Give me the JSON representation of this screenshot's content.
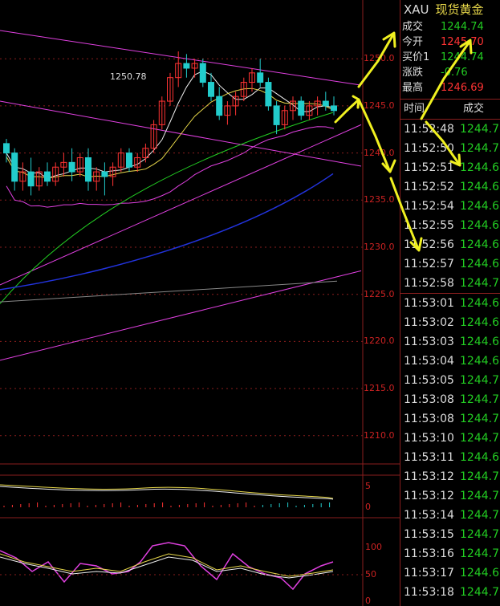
{
  "chart": {
    "high_callout": "1250.78",
    "price_axis": [
      "1250.0",
      "1245.0",
      "1240.0",
      "1235.0",
      "1230.0",
      "1225.0",
      "1220.0",
      "1215.0",
      "1210.0"
    ],
    "osc1_axis": [
      "5",
      "0"
    ],
    "osc2_axis": [
      "100",
      "50",
      "0"
    ]
  },
  "chart_data": {
    "type": "candlestick",
    "ylim": [
      1207,
      1253
    ],
    "yticks": [
      1250.0,
      1245.0,
      1240.0,
      1235.0,
      1230.0,
      1225.0,
      1220.0,
      1215.0,
      1210.0
    ],
    "candles": [
      {
        "o": 1241.0,
        "h": 1241.5,
        "l": 1239.0,
        "c": 1240.0
      },
      {
        "o": 1240.0,
        "h": 1240.5,
        "l": 1236.0,
        "c": 1237.0
      },
      {
        "o": 1237.0,
        "h": 1239.0,
        "l": 1236.0,
        "c": 1238.0
      },
      {
        "o": 1238.0,
        "h": 1239.5,
        "l": 1235.5,
        "c": 1236.5
      },
      {
        "o": 1236.5,
        "h": 1238.5,
        "l": 1236.0,
        "c": 1238.0
      },
      {
        "o": 1238.0,
        "h": 1239.0,
        "l": 1236.5,
        "c": 1237.0
      },
      {
        "o": 1237.0,
        "h": 1239.0,
        "l": 1236.5,
        "c": 1238.5
      },
      {
        "o": 1238.5,
        "h": 1240.0,
        "l": 1237.5,
        "c": 1239.0
      },
      {
        "o": 1239.0,
        "h": 1240.5,
        "l": 1237.0,
        "c": 1238.0
      },
      {
        "o": 1238.0,
        "h": 1240.0,
        "l": 1237.5,
        "c": 1239.5
      },
      {
        "o": 1239.5,
        "h": 1240.5,
        "l": 1236.0,
        "c": 1237.0
      },
      {
        "o": 1237.0,
        "h": 1238.5,
        "l": 1236.0,
        "c": 1238.0
      },
      {
        "o": 1238.0,
        "h": 1239.0,
        "l": 1235.5,
        "c": 1237.5
      },
      {
        "o": 1237.5,
        "h": 1239.0,
        "l": 1236.5,
        "c": 1238.5
      },
      {
        "o": 1238.5,
        "h": 1240.5,
        "l": 1238.0,
        "c": 1240.0
      },
      {
        "o": 1240.0,
        "h": 1240.5,
        "l": 1238.0,
        "c": 1238.5
      },
      {
        "o": 1238.5,
        "h": 1240.0,
        "l": 1238.0,
        "c": 1239.5
      },
      {
        "o": 1239.5,
        "h": 1241.0,
        "l": 1239.0,
        "c": 1240.5
      },
      {
        "o": 1240.5,
        "h": 1243.5,
        "l": 1240.0,
        "c": 1243.0
      },
      {
        "o": 1243.0,
        "h": 1246.0,
        "l": 1242.5,
        "c": 1245.5
      },
      {
        "o": 1245.5,
        "h": 1248.5,
        "l": 1245.0,
        "c": 1248.0
      },
      {
        "o": 1248.0,
        "h": 1250.78,
        "l": 1247.0,
        "c": 1249.5
      },
      {
        "o": 1249.5,
        "h": 1250.5,
        "l": 1248.0,
        "c": 1249.0
      },
      {
        "o": 1249.0,
        "h": 1250.0,
        "l": 1248.0,
        "c": 1249.5
      },
      {
        "o": 1249.5,
        "h": 1250.0,
        "l": 1247.0,
        "c": 1247.5
      },
      {
        "o": 1247.5,
        "h": 1248.5,
        "l": 1245.5,
        "c": 1246.0
      },
      {
        "o": 1246.0,
        "h": 1247.0,
        "l": 1243.5,
        "c": 1244.0
      },
      {
        "o": 1244.0,
        "h": 1245.5,
        "l": 1243.0,
        "c": 1245.0
      },
      {
        "o": 1245.0,
        "h": 1246.5,
        "l": 1244.0,
        "c": 1246.0
      },
      {
        "o": 1246.0,
        "h": 1248.0,
        "l": 1245.5,
        "c": 1247.5
      },
      {
        "o": 1247.5,
        "h": 1249.0,
        "l": 1246.5,
        "c": 1248.5
      },
      {
        "o": 1248.5,
        "h": 1250.0,
        "l": 1247.0,
        "c": 1247.5
      },
      {
        "o": 1247.5,
        "h": 1248.0,
        "l": 1244.5,
        "c": 1245.0
      },
      {
        "o": 1245.0,
        "h": 1245.5,
        "l": 1242.0,
        "c": 1243.0
      },
      {
        "o": 1243.0,
        "h": 1245.0,
        "l": 1242.5,
        "c": 1244.5
      },
      {
        "o": 1244.5,
        "h": 1246.0,
        "l": 1243.5,
        "c": 1245.5
      },
      {
        "o": 1245.5,
        "h": 1246.0,
        "l": 1243.5,
        "c": 1244.0
      },
      {
        "o": 1244.0,
        "h": 1245.5,
        "l": 1243.5,
        "c": 1245.0
      },
      {
        "o": 1245.0,
        "h": 1246.0,
        "l": 1244.0,
        "c": 1245.5
      },
      {
        "o": 1245.5,
        "h": 1246.5,
        "l": 1244.5,
        "c": 1245.0
      },
      {
        "o": 1245.0,
        "h": 1246.0,
        "l": 1244.0,
        "c": 1244.5
      }
    ]
  },
  "quote": {
    "symbol": "XAU",
    "name": "现货黄金",
    "rows": [
      {
        "label": "成交",
        "value": "1244.74",
        "color": "#22cc22"
      },
      {
        "label": "今开",
        "value": "1245.70",
        "color": "#ff3333"
      },
      {
        "label": "买价1",
        "value": "1244.74",
        "color": "#22cc22"
      },
      {
        "label": "涨跌",
        "value": "-0.76",
        "color": "#22cc22"
      },
      {
        "label": "最高",
        "value": "1246.69",
        "color": "#ff3333"
      }
    ]
  },
  "ticks": {
    "col_time": "时间",
    "col_deal": "成交",
    "rows": [
      {
        "time": "11:52:48",
        "price": "1244.7",
        "color": "#22cc22"
      },
      {
        "time": "11:52:50",
        "price": "1244.7",
        "color": "#22cc22"
      },
      {
        "time": "11:52:51",
        "price": "1244.6",
        "color": "#22cc22"
      },
      {
        "time": "11:52:52",
        "price": "1244.6",
        "color": "#22cc22"
      },
      {
        "time": "11:52:54",
        "price": "1244.6",
        "color": "#22cc22"
      },
      {
        "time": "11:52:55",
        "price": "1244.6",
        "color": "#22cc22"
      },
      {
        "time": "11:52:56",
        "price": "1244.6",
        "color": "#22cc22"
      },
      {
        "time": "11:52:57",
        "price": "1244.6",
        "color": "#22cc22"
      },
      {
        "time": "11:52:58",
        "price": "1244.7",
        "color": "#22cc22"
      },
      {
        "time": "11:53:01",
        "price": "1244.6",
        "color": "#22cc22"
      },
      {
        "time": "11:53:02",
        "price": "1244.6",
        "color": "#22cc22"
      },
      {
        "time": "11:53:03",
        "price": "1244.6",
        "color": "#22cc22"
      },
      {
        "time": "11:53:04",
        "price": "1244.6",
        "color": "#22cc22"
      },
      {
        "time": "11:53:05",
        "price": "1244.7",
        "color": "#22cc22"
      },
      {
        "time": "11:53:08",
        "price": "1244.7",
        "color": "#22cc22"
      },
      {
        "time": "11:53:08",
        "price": "1244.7",
        "color": "#22cc22"
      },
      {
        "time": "11:53:10",
        "price": "1244.7",
        "color": "#22cc22"
      },
      {
        "time": "11:53:11",
        "price": "1244.6",
        "color": "#22cc22"
      },
      {
        "time": "11:53:12",
        "price": "1244.7",
        "color": "#22cc22"
      },
      {
        "time": "11:53:12",
        "price": "1244.7",
        "color": "#22cc22"
      },
      {
        "time": "11:53:14",
        "price": "1244.7",
        "color": "#22cc22"
      },
      {
        "time": "11:53:15",
        "price": "1244.7",
        "color": "#22cc22"
      },
      {
        "time": "11:53:16",
        "price": "1244.7",
        "color": "#22cc22"
      },
      {
        "time": "11:53:17",
        "price": "1244.6",
        "color": "#22cc22"
      },
      {
        "time": "11:53:18",
        "price": "1244.7",
        "color": "#22cc22"
      }
    ]
  },
  "colors": {
    "up": "#ff3333",
    "down": "#22cccc",
    "grid": "#8a1e1e",
    "trendline": "#e040e0",
    "ma_white": "#eeeeee",
    "ma_yellow": "#e8d84a",
    "ma_green": "#22cc22",
    "ma_blue": "#2233dd",
    "ma_gray": "#888888",
    "annotation_arrow": "#f0f020"
  }
}
